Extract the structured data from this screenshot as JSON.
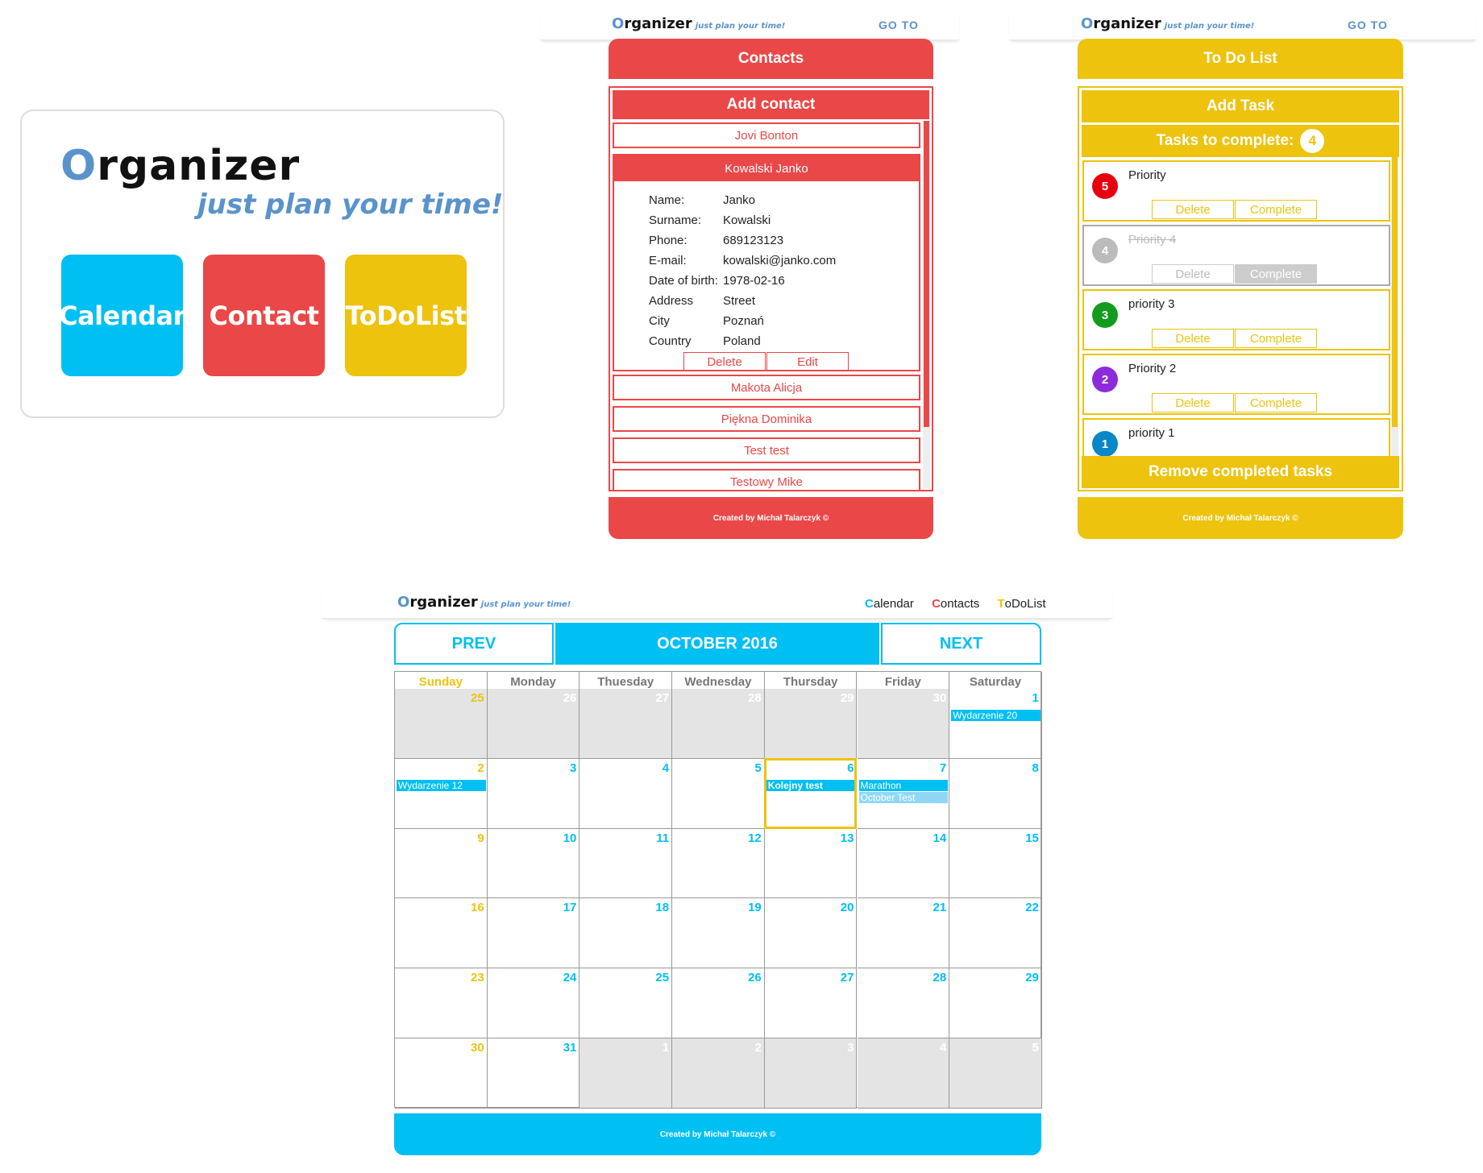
{
  "landing": {
    "brand_first": "O",
    "brand_rest": "rganizer",
    "tagline": "just plan your time!",
    "tiles": [
      "Calendar",
      "Contact",
      "ToDoList"
    ]
  },
  "nav_contacts": {
    "brand_first": "O",
    "brand_rest": "rganizer",
    "tagline": "just plan your time!",
    "goto": "GO TO"
  },
  "nav_todo": {
    "brand_first": "O",
    "brand_rest": "rganizer",
    "tagline": "just plan your time!",
    "goto": "GO TO"
  },
  "contacts": {
    "title": "Contacts",
    "add_contact": "Add contact",
    "list_top": [
      "Jovi Bonton"
    ],
    "expanded": {
      "name": "Kowalski Janko",
      "fields": [
        {
          "label": "Name:",
          "value": "Janko"
        },
        {
          "label": "Surname:",
          "value": "Kowalski"
        },
        {
          "label": "Phone:",
          "value": "689123123"
        },
        {
          "label": "E-mail:",
          "value": "kowalski@janko.com"
        },
        {
          "label": "Date of birth:",
          "value": "1978-02-16"
        },
        {
          "label": "Address",
          "value": "Street"
        },
        {
          "label": "City",
          "value": "Poznań"
        },
        {
          "label": "Country",
          "value": "Poland"
        }
      ],
      "delete_label": "Delete",
      "edit_label": "Edit"
    },
    "list_bottom": [
      "Makota Alicja",
      "Piękna Dominika",
      "Test test",
      "Testowy Mike"
    ],
    "footer": "Created by Michał Talarczyk ©"
  },
  "todo": {
    "title": "To Do List",
    "add_task": "Add Task",
    "tasks_label": "Tasks to complete:",
    "tasks_count": "4",
    "tasks": [
      {
        "priority": "5",
        "text": "Priority",
        "color": "#e6000e",
        "done": false
      },
      {
        "priority": "4",
        "text": "Priority 4",
        "color": "#bbbbbb",
        "done": true
      },
      {
        "priority": "3",
        "text": "priority 3",
        "color": "#129b1d",
        "done": false
      },
      {
        "priority": "2",
        "text": "Priority 2",
        "color": "#8d2bdc",
        "done": false
      },
      {
        "priority": "1",
        "text": "priority 1",
        "color": "#0a87c6",
        "done": false
      }
    ],
    "delete_label": "Delete",
    "complete_label": "Complete",
    "remove_completed": "Remove completed tasks",
    "footer": "Created by Michał Talarczyk ©"
  },
  "calendar": {
    "nav": {
      "brand_first": "O",
      "brand_rest": "rganizer",
      "tagline": "just plan your time!",
      "links": [
        {
          "first": "C",
          "rest": "alendar",
          "color": "#00bff3"
        },
        {
          "first": "C",
          "rest": "ontacts",
          "color": "#ea4748"
        },
        {
          "first": "T",
          "rest": "oDoList",
          "color": "#edc30e"
        }
      ]
    },
    "prev": "PREV",
    "month": "OCTOBER 2016",
    "next": "NEXT",
    "weekdays": [
      "Sunday",
      "Monday",
      "Thuesday",
      "Wednesday",
      "Thursday",
      "Friday",
      "Saturday"
    ],
    "weeks": [
      [
        {
          "d": "25",
          "o": true
        },
        {
          "d": "26",
          "o": true
        },
        {
          "d": "27",
          "o": true
        },
        {
          "d": "28",
          "o": true
        },
        {
          "d": "29",
          "o": true
        },
        {
          "d": "30",
          "o": true
        },
        {
          "d": "1",
          "ev": [
            {
              "t": "Wydarzenie 20"
            }
          ]
        }
      ],
      [
        {
          "d": "2",
          "ev": [
            {
              "t": "Wydarzenie 12"
            }
          ]
        },
        {
          "d": "3"
        },
        {
          "d": "4"
        },
        {
          "d": "5"
        },
        {
          "d": "6",
          "today": true,
          "ev": [
            {
              "t": "Kolejny test"
            }
          ]
        },
        {
          "d": "7",
          "ev": [
            {
              "t": "Marathon"
            },
            {
              "t": "October Test",
              "light": true
            }
          ]
        },
        {
          "d": "8"
        }
      ],
      [
        {
          "d": "9"
        },
        {
          "d": "10"
        },
        {
          "d": "11"
        },
        {
          "d": "12"
        },
        {
          "d": "13"
        },
        {
          "d": "14"
        },
        {
          "d": "15"
        }
      ],
      [
        {
          "d": "16"
        },
        {
          "d": "17"
        },
        {
          "d": "18"
        },
        {
          "d": "19"
        },
        {
          "d": "20"
        },
        {
          "d": "21"
        },
        {
          "d": "22"
        }
      ],
      [
        {
          "d": "23"
        },
        {
          "d": "24"
        },
        {
          "d": "25"
        },
        {
          "d": "26"
        },
        {
          "d": "27"
        },
        {
          "d": "28"
        },
        {
          "d": "29"
        }
      ],
      [
        {
          "d": "30"
        },
        {
          "d": "31"
        },
        {
          "d": "1",
          "o": true
        },
        {
          "d": "2",
          "o": true
        },
        {
          "d": "3",
          "o": true
        },
        {
          "d": "4",
          "o": true
        },
        {
          "d": "5",
          "o": true
        }
      ]
    ],
    "footer": "Created by Michał Talarczyk ©"
  },
  "colors": {
    "blue": "#00bff3",
    "red": "#ea4748",
    "yellow": "#edc30e",
    "brand": "#5a93cc"
  }
}
